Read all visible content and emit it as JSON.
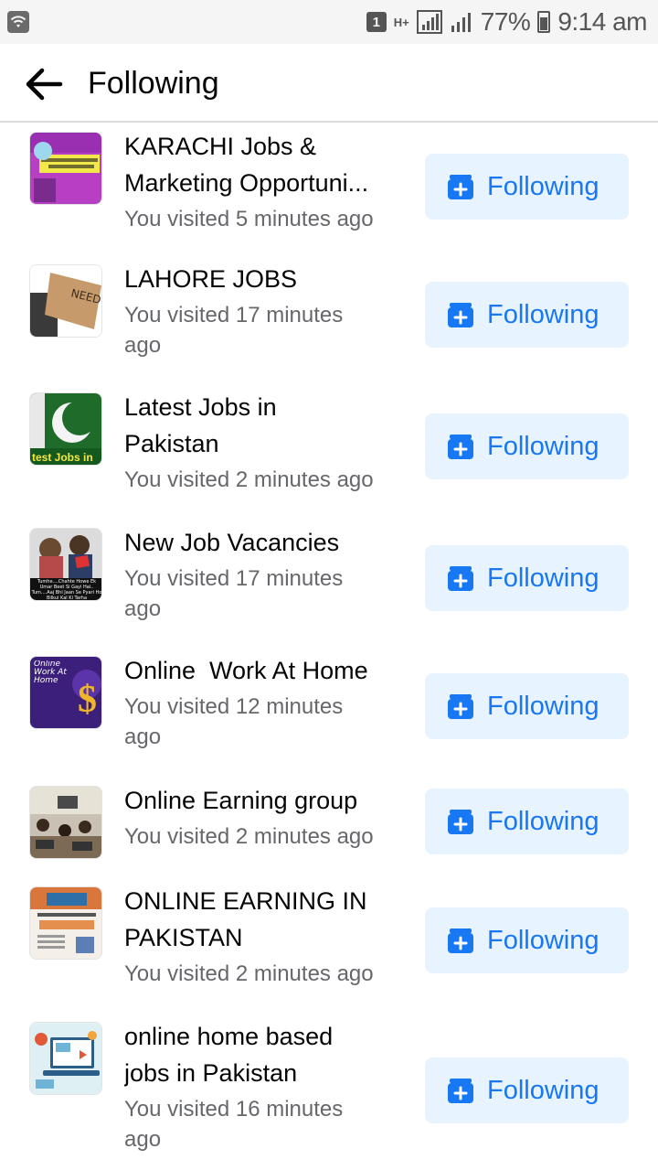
{
  "status_bar": {
    "notification_count": "1",
    "network_type": "H+",
    "battery_percent": "77%",
    "time": "9:14 am"
  },
  "header": {
    "title": "Following",
    "back_icon": "arrow-left-icon"
  },
  "groups": [
    {
      "title": "KARACHI Jobs & Marketing Opportuni...",
      "visited": "You visited 5 minutes ago",
      "button_label": "Following"
    },
    {
      "title": "LAHORE JOBS",
      "visited": "You visited 17 minutes ago",
      "button_label": "Following"
    },
    {
      "title": "Latest Jobs in Pakistan",
      "visited": "You visited 2 minutes ago",
      "button_label": "Following"
    },
    {
      "title": "New Job Vacancies",
      "visited": "You visited 17 minutes ago",
      "button_label": "Following"
    },
    {
      "title": "Online  Work At Home",
      "visited": "You visited 12 minutes ago",
      "button_label": "Following"
    },
    {
      "title": "Online Earning group",
      "visited": "You visited 2 minutes ago",
      "button_label": "Following"
    },
    {
      "title": "ONLINE EARNING IN PAKISTAN",
      "visited": "You visited 2 minutes ago",
      "button_label": "Following"
    },
    {
      "title": "online home based jobs in Pakistan",
      "visited": "You visited 16 minutes ago",
      "button_label": "Following"
    }
  ],
  "thumb_texts": {
    "lahore_sign": "NEED A JOB",
    "latest_jobs_banner": "test Jobs in",
    "new_vacancies_caption": "Tumhe....Chahte Howe Ek Umar Beet Si Gayi Hai.. Tum....Aaj Bhi Jaan Se Pyari Ho Bilkul Kal Ki Tarha",
    "online_work_text": "Online Work At Home"
  },
  "colors": {
    "accent": "#1877f2",
    "button_bg": "#e7f3ff",
    "secondary_text": "#65676b"
  }
}
